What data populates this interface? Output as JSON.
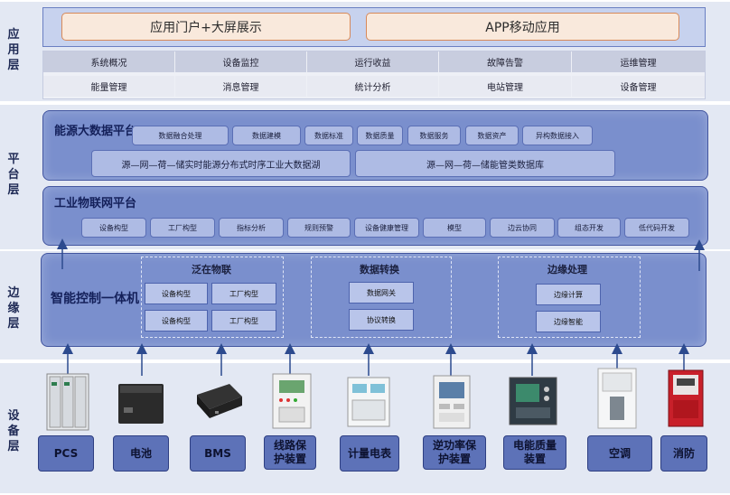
{
  "layers": {
    "app": [
      "应",
      "用",
      "层"
    ],
    "platform": [
      "平",
      "台",
      "层"
    ],
    "edge": [
      "边",
      "缘",
      "层"
    ],
    "device": [
      "设",
      "备",
      "层"
    ]
  },
  "app_layer": {
    "portal": "应用门户+大屏展示",
    "mobile": "APP移动应用",
    "row1": [
      "系统概况",
      "设备监控",
      "运行收益",
      "故障告警",
      "运维管理"
    ],
    "row2": [
      "能量管理",
      "消息管理",
      "统计分析",
      "电站管理",
      "设备管理"
    ]
  },
  "platform_layer": {
    "big_data": {
      "title": "能源大数据平台",
      "chips": [
        "数据融合处理",
        "数据建模",
        "数据标准",
        "数据质量",
        "数据服务",
        "数据资产",
        "异构数据接入"
      ],
      "wide": [
        "源—网—荷—储实时能源分布式时序工业大数据湖",
        "源—网—荷—储能管类数据库"
      ]
    },
    "iot": {
      "title": "工业物联网平台",
      "chips": [
        "设备构型",
        "工厂构型",
        "指标分析",
        "规则预警",
        "设备健康管理",
        "模型",
        "边云协同",
        "组态开发",
        "低代码开发"
      ]
    }
  },
  "edge_layer": {
    "main_label": "智能控制一体机",
    "iot_title": "泛在物联",
    "iot_chips": [
      "设备构型",
      "工厂构型",
      "设备构型",
      "工厂构型"
    ],
    "conv_title": "数据转换",
    "conv_chips": [
      "数据网关",
      "协议转换"
    ],
    "proc_title": "边缘处理",
    "proc_chips": [
      "边缘计算",
      "边缘智能"
    ]
  },
  "device_layer": {
    "devices": [
      {
        "label": "PCS",
        "icon": "pcs-cabinet"
      },
      {
        "label": "电池",
        "icon": "battery-box"
      },
      {
        "label": "BMS",
        "icon": "bms-unit"
      },
      {
        "label": "线路保护装置",
        "icon": "line-protection-device"
      },
      {
        "label": "计量电表",
        "icon": "energy-meter"
      },
      {
        "label": "逆功率保护装置",
        "icon": "reverse-power-protector"
      },
      {
        "label": "电能质量装置",
        "icon": "power-quality-device"
      },
      {
        "label": "空调",
        "icon": "air-conditioner"
      },
      {
        "label": "消防",
        "icon": "fire-panel"
      }
    ]
  }
}
